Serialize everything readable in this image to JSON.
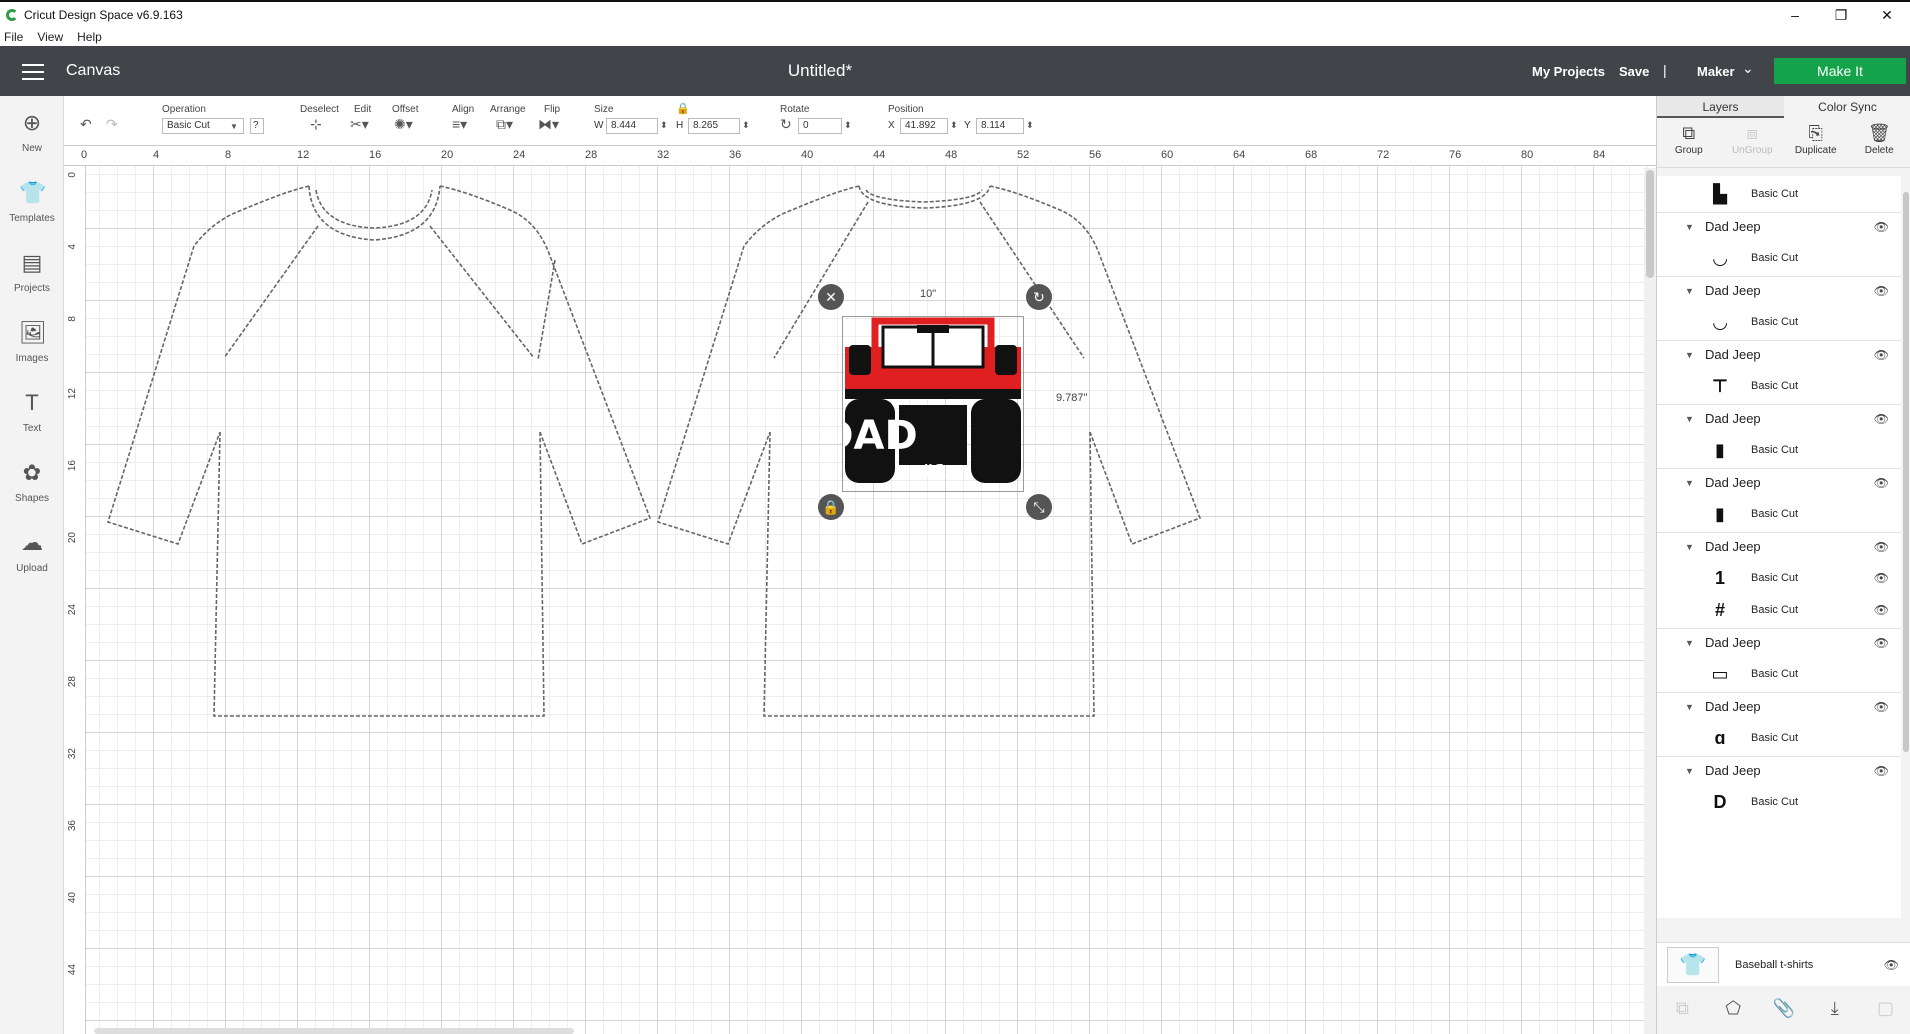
{
  "window": {
    "title": "Cricut Design Space  v6.9.163",
    "minimize": "–",
    "maximize": "❐",
    "close": "✕"
  },
  "menu": [
    "File",
    "View",
    "Help"
  ],
  "header": {
    "section": "Canvas",
    "doc_title": "Untitled*",
    "my_projects": "My Projects",
    "save": "Save",
    "separator": "|",
    "machine": "Maker",
    "make_it": "Make It"
  },
  "left_tools": [
    {
      "label": "New",
      "icon": "plus-circle-icon",
      "glyph": "⊕"
    },
    {
      "label": "Templates",
      "icon": "shirt-icon",
      "glyph": "👕"
    },
    {
      "label": "Projects",
      "icon": "projects-icon",
      "glyph": "▤"
    },
    {
      "label": "Images",
      "icon": "image-icon",
      "glyph": "🖼"
    },
    {
      "label": "Text",
      "icon": "text-icon",
      "glyph": "T"
    },
    {
      "label": "Shapes",
      "icon": "shapes-icon",
      "glyph": "✿"
    },
    {
      "label": "Upload",
      "icon": "upload-cloud-icon",
      "glyph": "☁"
    }
  ],
  "toolbar": {
    "operation_label": "Operation",
    "operation_value": "Basic Cut",
    "deselect": "Deselect",
    "edit": "Edit",
    "offset": "Offset",
    "align": "Align",
    "arrange": "Arrange",
    "flip": "Flip",
    "size_label": "Size",
    "w_label": "W",
    "w_value": "8.444",
    "h_label": "H",
    "h_value": "8.265",
    "rotate_label": "Rotate",
    "rotate_value": "0",
    "position_label": "Position",
    "x_label": "X",
    "x_value": "41.892",
    "y_label": "Y",
    "y_value": "8.114"
  },
  "ruler_h": [
    "0",
    "4",
    "8",
    "12",
    "16",
    "20",
    "24",
    "28",
    "32",
    "36",
    "40",
    "44",
    "48",
    "52",
    "56",
    "60",
    "64",
    "68",
    "72",
    "76",
    "80",
    "84"
  ],
  "ruler_v": [
    "0",
    "4",
    "8",
    "12",
    "16",
    "20",
    "24",
    "28",
    "32",
    "36",
    "40",
    "44"
  ],
  "selection": {
    "width_label": "10\"",
    "height_label": "9.787\""
  },
  "design_text": {
    "dad": "DAD",
    "number": "#1"
  },
  "panel": {
    "tabs": [
      "Layers",
      "Color Sync"
    ],
    "actions": [
      {
        "label": "Group",
        "icon": "group-icon",
        "glyph": "⧉",
        "enabled": true
      },
      {
        "label": "UnGroup",
        "icon": "ungroup-icon",
        "glyph": "⧈",
        "enabled": false
      },
      {
        "label": "Duplicate",
        "icon": "duplicate-icon",
        "glyph": "⎘",
        "enabled": true
      },
      {
        "label": "Delete",
        "icon": "trash-icon",
        "glyph": "🗑",
        "enabled": true
      }
    ],
    "layers": [
      {
        "type": "item",
        "name": "Basic Cut",
        "thumb": "▙"
      },
      {
        "type": "group",
        "name": "Dad Jeep"
      },
      {
        "type": "item",
        "name": "Basic Cut",
        "thumb": "◡"
      },
      {
        "type": "group",
        "name": "Dad Jeep"
      },
      {
        "type": "item",
        "name": "Basic Cut",
        "thumb": "◡"
      },
      {
        "type": "group",
        "name": "Dad Jeep"
      },
      {
        "type": "item",
        "name": "Basic Cut",
        "thumb": "⊤"
      },
      {
        "type": "group",
        "name": "Dad Jeep"
      },
      {
        "type": "item",
        "name": "Basic Cut",
        "thumb": "▮"
      },
      {
        "type": "group",
        "name": "Dad Jeep"
      },
      {
        "type": "item",
        "name": "Basic Cut",
        "thumb": "▮"
      },
      {
        "type": "group",
        "name": "Dad Jeep"
      },
      {
        "type": "item",
        "name": "Basic Cut",
        "thumb": "1"
      },
      {
        "type": "item",
        "name": "Basic Cut",
        "thumb": "#"
      },
      {
        "type": "group",
        "name": "Dad Jeep"
      },
      {
        "type": "item",
        "name": "Basic Cut",
        "thumb": "▭"
      },
      {
        "type": "group",
        "name": "Dad Jeep"
      },
      {
        "type": "item",
        "name": "Basic Cut",
        "thumb": "ɑ"
      },
      {
        "type": "group",
        "name": "Dad Jeep"
      },
      {
        "type": "item",
        "name": "Basic Cut",
        "thumb": "D"
      }
    ],
    "base_layer": "Baseball t-shirts",
    "bottom_actions": [
      {
        "icon": "slice-icon",
        "glyph": "⧉"
      },
      {
        "icon": "weld-icon",
        "glyph": "⬠"
      },
      {
        "icon": "attach-icon",
        "glyph": "📎"
      },
      {
        "icon": "flatten-icon",
        "glyph": "⤓"
      },
      {
        "icon": "contour-icon",
        "glyph": "▢"
      }
    ]
  },
  "colors": {
    "header_bg": "#414549",
    "make_it": "#14a34a",
    "jeep_red": "#e02020"
  }
}
